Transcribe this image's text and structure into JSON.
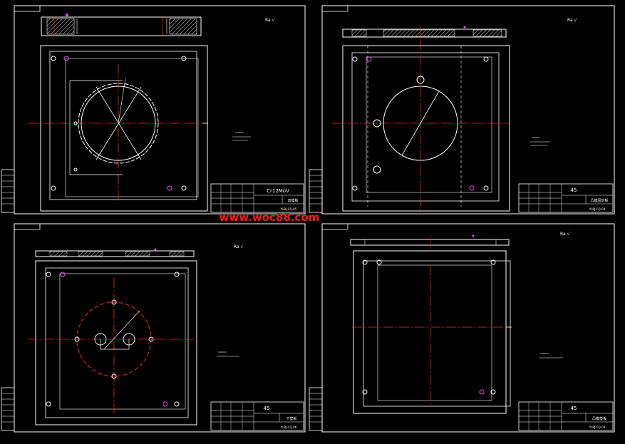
{
  "colors": {
    "background": "#000000",
    "line": "#ffffff",
    "center_line": "#ff2020",
    "accent": "#ff40ff",
    "watermark": "#ff2222"
  },
  "watermark": "www.woc88.com",
  "sheets": [
    {
      "material": "Cr12MoV",
      "part_name": "凹模板",
      "drawing_no": "YLBJ-CQ-05"
    },
    {
      "material": "45",
      "part_name": "凸模固定板",
      "drawing_no": "YLBJ-CQ-04"
    },
    {
      "material": "45",
      "part_name": "下垫板",
      "drawing_no": "YLBJ-CQ-06"
    },
    {
      "material": "45",
      "part_name": "凸模垫板",
      "drawing_no": "YLBJ-CQ-03"
    }
  ]
}
